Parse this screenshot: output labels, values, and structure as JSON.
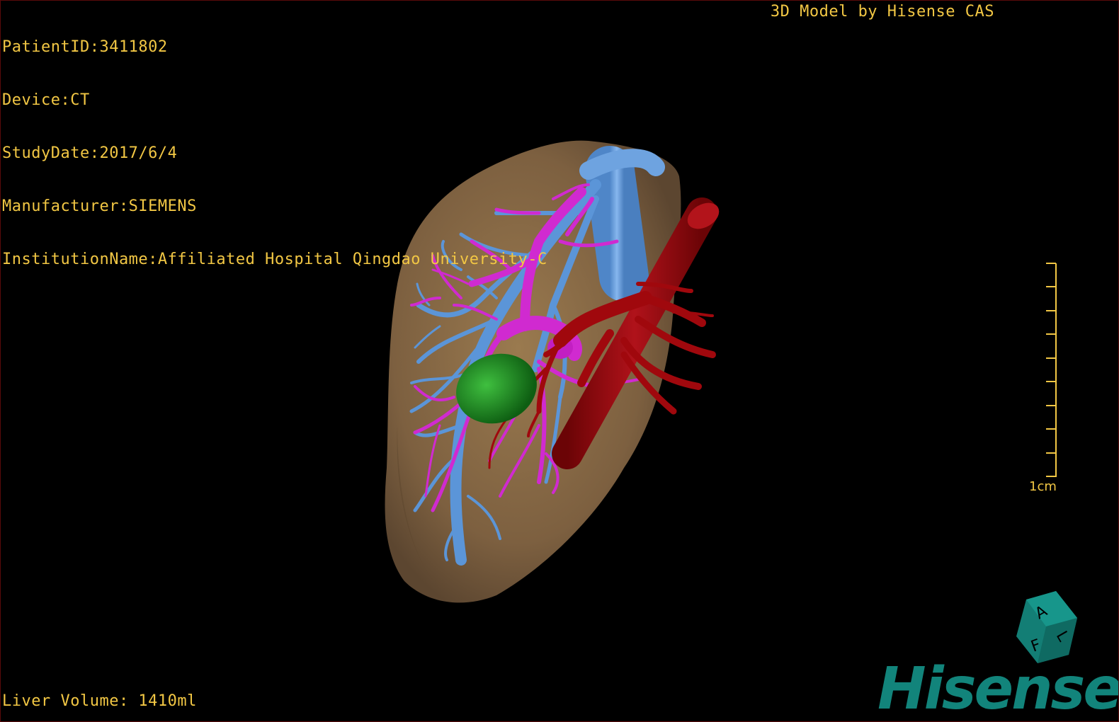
{
  "patient_info": {
    "lines": [
      "PatientID:3411802",
      "Device:CT",
      "StudyDate:2017/6/4",
      "Manufacturer:SIEMENS",
      "InstitutionName:Affiliated Hospital Qingdao University-C"
    ]
  },
  "brand_title": "3D Model by Hisense CAS",
  "liver_volume": "Liver Volume: 1410ml",
  "scale": {
    "label": "1cm",
    "ticks": 10
  },
  "orientation_cube": {
    "faces": [
      "A",
      "F",
      "L"
    ],
    "color": "#137e75"
  },
  "logo_text": "Hisense",
  "colors": {
    "overlay_text": "#f2c744",
    "liver": "#8b6c44",
    "hepatic_vein": "#5b95d8",
    "portal_vein": "#d02ad0",
    "artery_ivc": "#a0080d",
    "gallbladder": "#1f8b1f",
    "brand": "#12847b"
  }
}
